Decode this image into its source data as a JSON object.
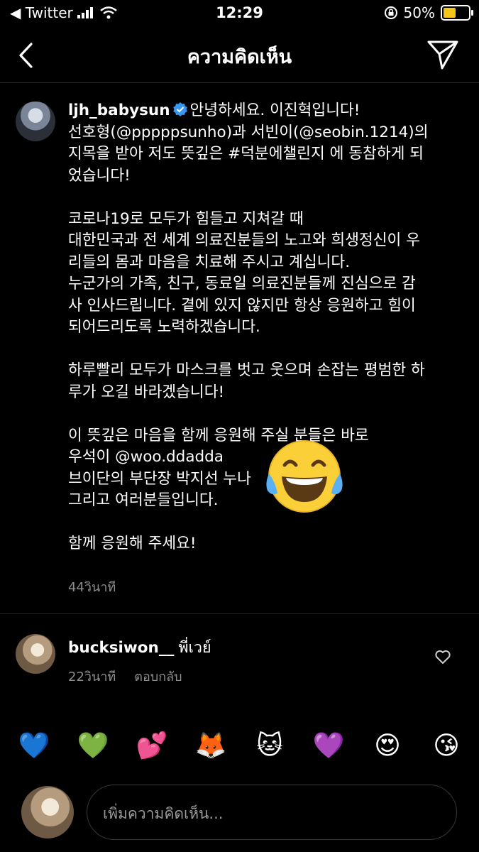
{
  "status_bar": {
    "carrier": "◀ Twitter",
    "time": "12:29",
    "battery": "50%",
    "battery_level": 0.5
  },
  "nav": {
    "title": "ความคิดเห็น",
    "back_icon": "chevron-left-icon",
    "send_icon": "paper-plane-icon"
  },
  "caption": {
    "username": "ljh_babysun",
    "verified": true,
    "text": "안녕하세요. 이진혁입니다!\n선호형(@pppppsunho)과 서빈이(@seobin.1214)의\n지목을 받아 저도 뜻깊은 #덕분에챌린지 에 동참하게 되\n었습니다!\n\n코로나19로 모두가 힘들고 지쳐갈 때\n대한민국과 전 세계 의료진분들의 노고와 희생정신이 우\n리들의 몸과 마음을 치료해 주시고 계십니다.\n누군가의 가족, 친구, 동료일 의료진분들께 진심으로 감\n사 인사드립니다. 곁에 있지 않지만 항상 응원하고 힘이\n되어드리도록 노력하겠습니다.\n\n하루빨리 모두가 마스크를 벗고 웃으며 손잡는 평범한 하\n루가 오길 바라겠습니다!\n\n이 뜻깊은 마음을 함께 응원해 주실 분들은 바로\n우석이 @woo.ddadda\n브이단의 부단장 박지선 누나\n그리고 여러분들입니다.\n\n함께 응원해 주세요!",
    "time_ago": "44วินาที",
    "overlay_emoji": "😂"
  },
  "comment": {
    "username": "bucksiwon__",
    "text": "พี่เวย์",
    "time_ago": "22วินาที",
    "reply_label": "ตอบกลับ",
    "like_icon": "heart-outline-icon"
  },
  "emoji_row": [
    "💙",
    "💚",
    "💕",
    "🦊",
    "🐱",
    "💜",
    "😍",
    "😘"
  ],
  "input": {
    "placeholder": "เพิ่มความคิดเห็น..."
  }
}
